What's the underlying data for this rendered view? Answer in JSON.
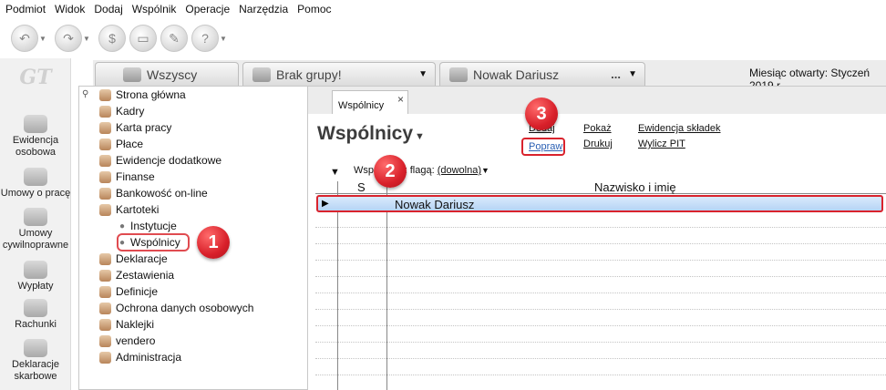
{
  "menu": [
    "Podmiot",
    "Widok",
    "Dodaj",
    "Wspólnik",
    "Operacje",
    "Narzędzia",
    "Pomoc"
  ],
  "toolbar_icons": [
    "back-icon",
    "forward-icon",
    "money-icon",
    "eraser-icon",
    "edit-icon",
    "help-icon"
  ],
  "logo_text": "GT",
  "left_rail": [
    {
      "label": "Ewidencja osobowa",
      "icon": "people-icon"
    },
    {
      "label": "Umowy o pracę",
      "icon": "contract-icon"
    },
    {
      "label": "Umowy cywilnoprawne",
      "icon": "civil-contract-icon"
    },
    {
      "label": "Wypłaty",
      "icon": "payout-icon"
    },
    {
      "label": "Rachunki",
      "icon": "invoice-icon"
    },
    {
      "label": "Deklaracje skarbowe",
      "icon": "tax-declaration-icon"
    }
  ],
  "context_tabs": {
    "all": "Wszyscy",
    "group": "Brak grupy!",
    "person": "Nowak Dariusz",
    "person_more": "...",
    "month_label": "Miesiąc otwarty: Styczeń 2019 r."
  },
  "tree": {
    "items": [
      "Strona główna",
      "Kadry",
      "Karta pracy",
      "Płace",
      "Ewidencje dodatkowe",
      "Finanse",
      "Bankowość on-line",
      "Kartoteki"
    ],
    "kartoteki_children": [
      "Instytucje",
      "Wspólnicy"
    ],
    "items_after": [
      "Deklaracje",
      "Zestawienia",
      "Definicje",
      "Ochrona danych osobowych",
      "Naklejki",
      "vendero",
      "Administracja"
    ]
  },
  "main": {
    "tab_label": "Wspólnicy",
    "tab_close": "×",
    "title": "Wspólnicy",
    "actions": {
      "dodaj": "Dodaj",
      "popraw": "Popraw",
      "pokaz": "Pokaż",
      "drukuj": "Drukuj",
      "ewidencja": "Ewidencja składek",
      "wylicz": "Wylicz PIT"
    },
    "filter_label": "Wspólnicy z flagą:",
    "filter_value": "(dowolna)",
    "columns": [
      "S",
      "Nazwisko i imię"
    ],
    "rows": [
      {
        "s": "",
        "name": "Nowak Dariusz"
      }
    ]
  },
  "steps": [
    "1",
    "2",
    "3"
  ],
  "colors": {
    "highlight": "#d9232d",
    "selection": "#b6d4f5",
    "link": "#2a5fb3"
  }
}
